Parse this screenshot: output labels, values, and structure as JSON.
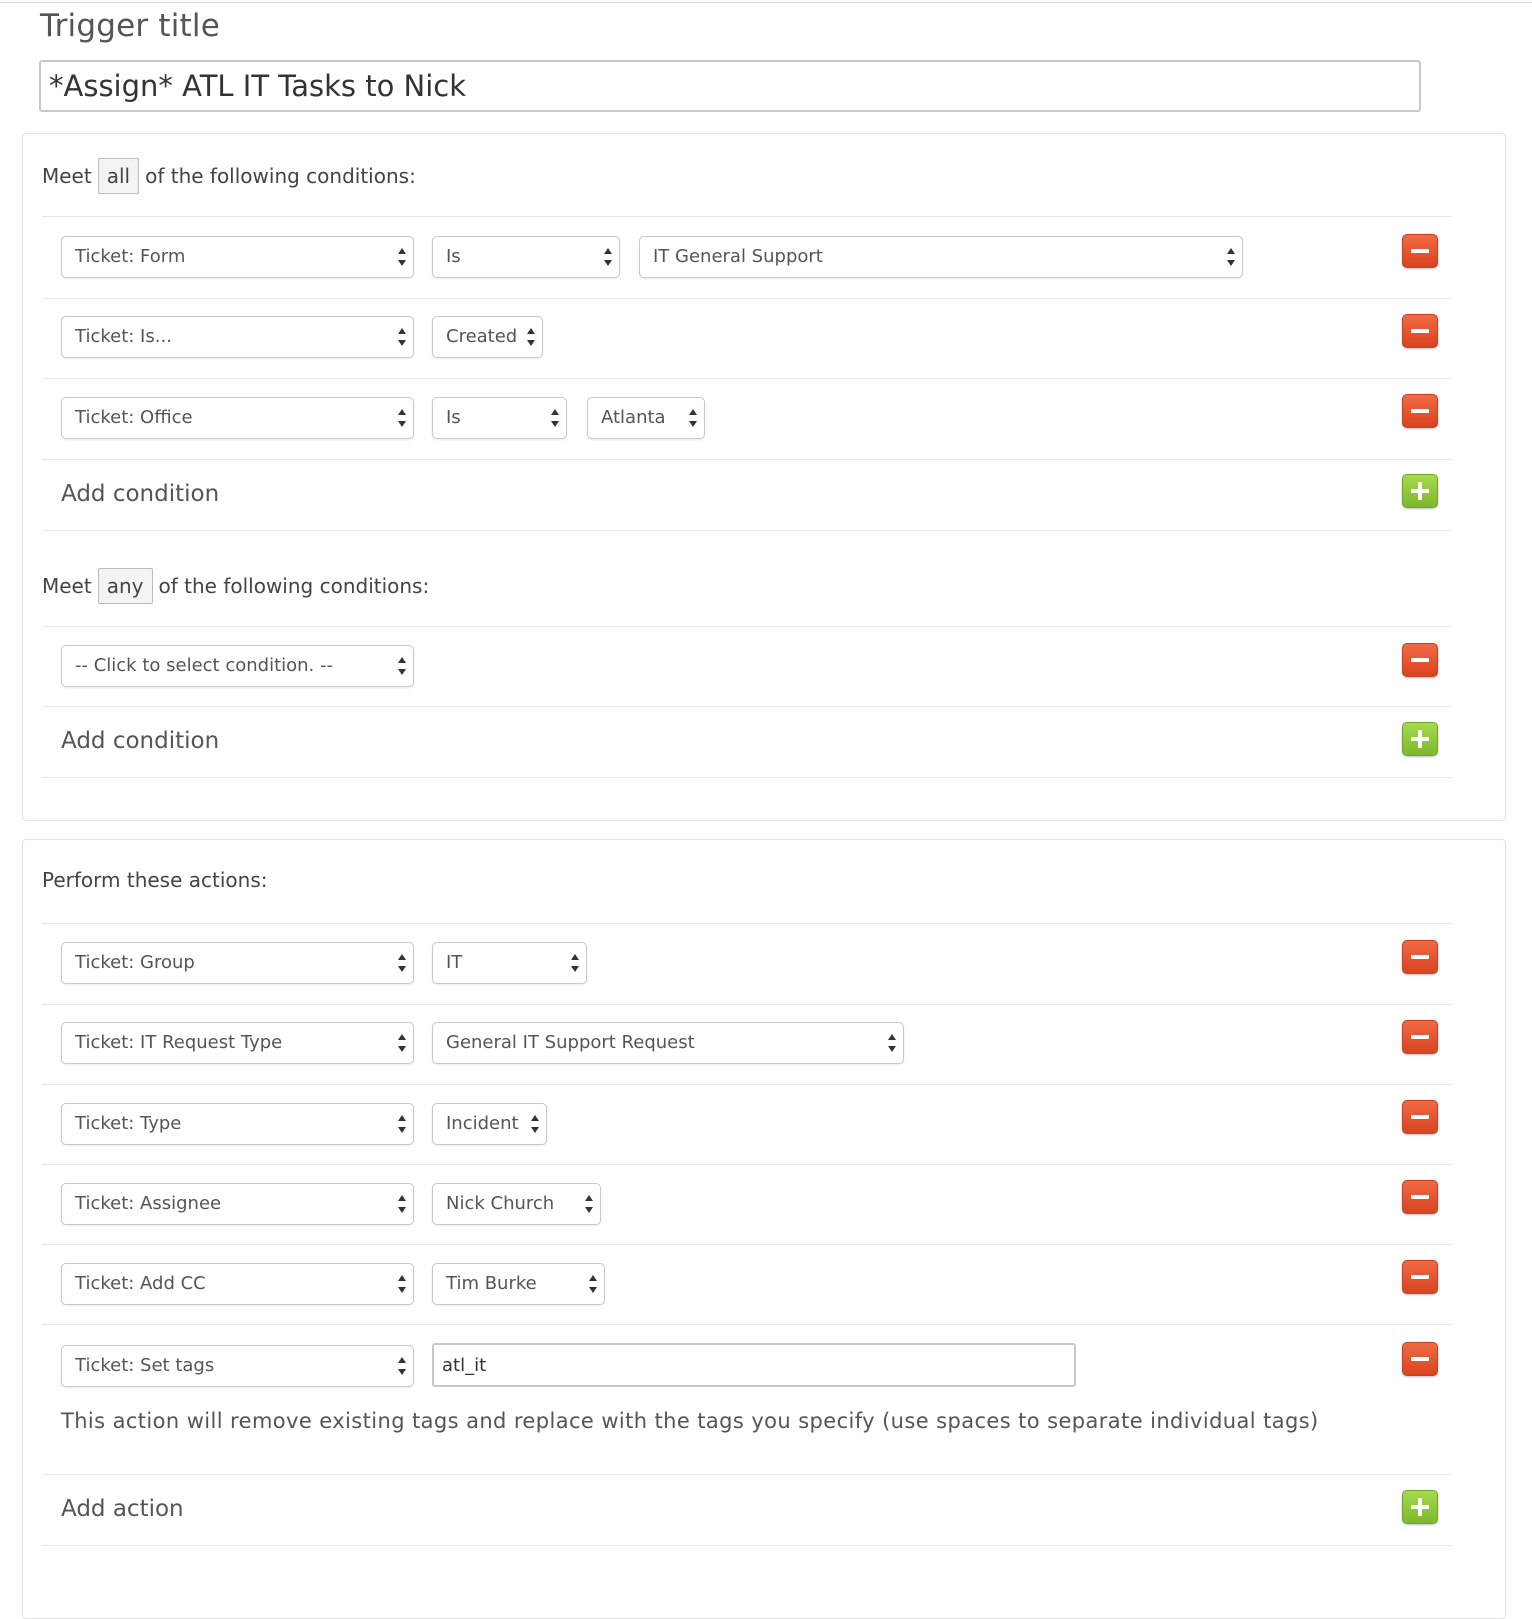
{
  "trigger": {
    "title_label": "Trigger title",
    "title_value": "*Assign* ATL IT Tasks to Nick"
  },
  "conditions_all": {
    "prefix": "Meet",
    "mode": "all",
    "suffix": "of the following conditions:",
    "rows": [
      {
        "field": "Ticket: Form",
        "operator": "Is",
        "value": "IT General Support"
      },
      {
        "field": "Ticket: Is...",
        "operator": "Created"
      },
      {
        "field": "Ticket: Office",
        "operator": "Is",
        "value": "Atlanta"
      }
    ],
    "add_label": "Add condition"
  },
  "conditions_any": {
    "prefix": "Meet",
    "mode": "any",
    "suffix": "of the following conditions:",
    "rows": [
      {
        "field": "-- Click to select condition. --"
      }
    ],
    "add_label": "Add condition"
  },
  "actions": {
    "title": "Perform these actions:",
    "rows": [
      {
        "field": "Ticket: Group",
        "value": "IT"
      },
      {
        "field": "Ticket: IT Request Type",
        "value": "General IT Support Request"
      },
      {
        "field": "Ticket: Type",
        "value": "Incident"
      },
      {
        "field": "Ticket: Assignee",
        "value": "Nick Church"
      },
      {
        "field": "Ticket: Add CC",
        "value": "Tim Burke"
      },
      {
        "field": "Ticket: Set tags",
        "value": "atl_it"
      }
    ],
    "tags_help": "This action will remove existing tags and replace with the tags you specify (use spaces to separate individual tags)",
    "add_label": "Add action"
  },
  "colors": {
    "remove_button": "#e05a32",
    "add_button": "#8cc63f"
  },
  "icons": {
    "remove": "minus-icon",
    "add": "plus-icon",
    "select_arrows": "up-down-arrows-icon"
  }
}
